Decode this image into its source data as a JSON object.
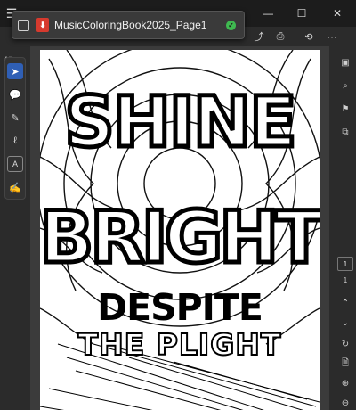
{
  "app": {
    "menu_icon": "hamburger-icon",
    "all_tools_label": "All"
  },
  "tab": {
    "title": "MusicColoringBook2025_Page1",
    "file_icon": "pdf-icon",
    "status_icon": "saved-check-icon",
    "status_color": "#3fb950"
  },
  "window": {
    "minimize_icon": "minimize-icon",
    "maximize_icon": "maximize-icon",
    "close_icon": "close-icon"
  },
  "toolbar": {
    "icons": [
      "upload-icon",
      "print-icon",
      "share-icon",
      "more-icon"
    ]
  },
  "left_tools": [
    "select-icon",
    "comment-icon",
    "draw-icon",
    "lasso-icon",
    "text-select-icon",
    "sign-icon"
  ],
  "right_rail": {
    "icons": [
      "panel-icon",
      "search-icon",
      "bookmark-icon",
      "copy-icon"
    ],
    "current_page": "1",
    "total_pages": "1",
    "bottom_icons": [
      "chevron-up-icon",
      "chevron-down-icon",
      "refresh-icon",
      "save-icon",
      "zoom-in-icon",
      "zoom-out-icon"
    ]
  },
  "artwork": {
    "line1": "SHINE",
    "line2": "BRIGHT",
    "line3": "DESPITE",
    "line4": "THE PLIGHT"
  },
  "colors": {
    "accent": "#2f5fb5",
    "pdf_red": "#d63a2e"
  }
}
